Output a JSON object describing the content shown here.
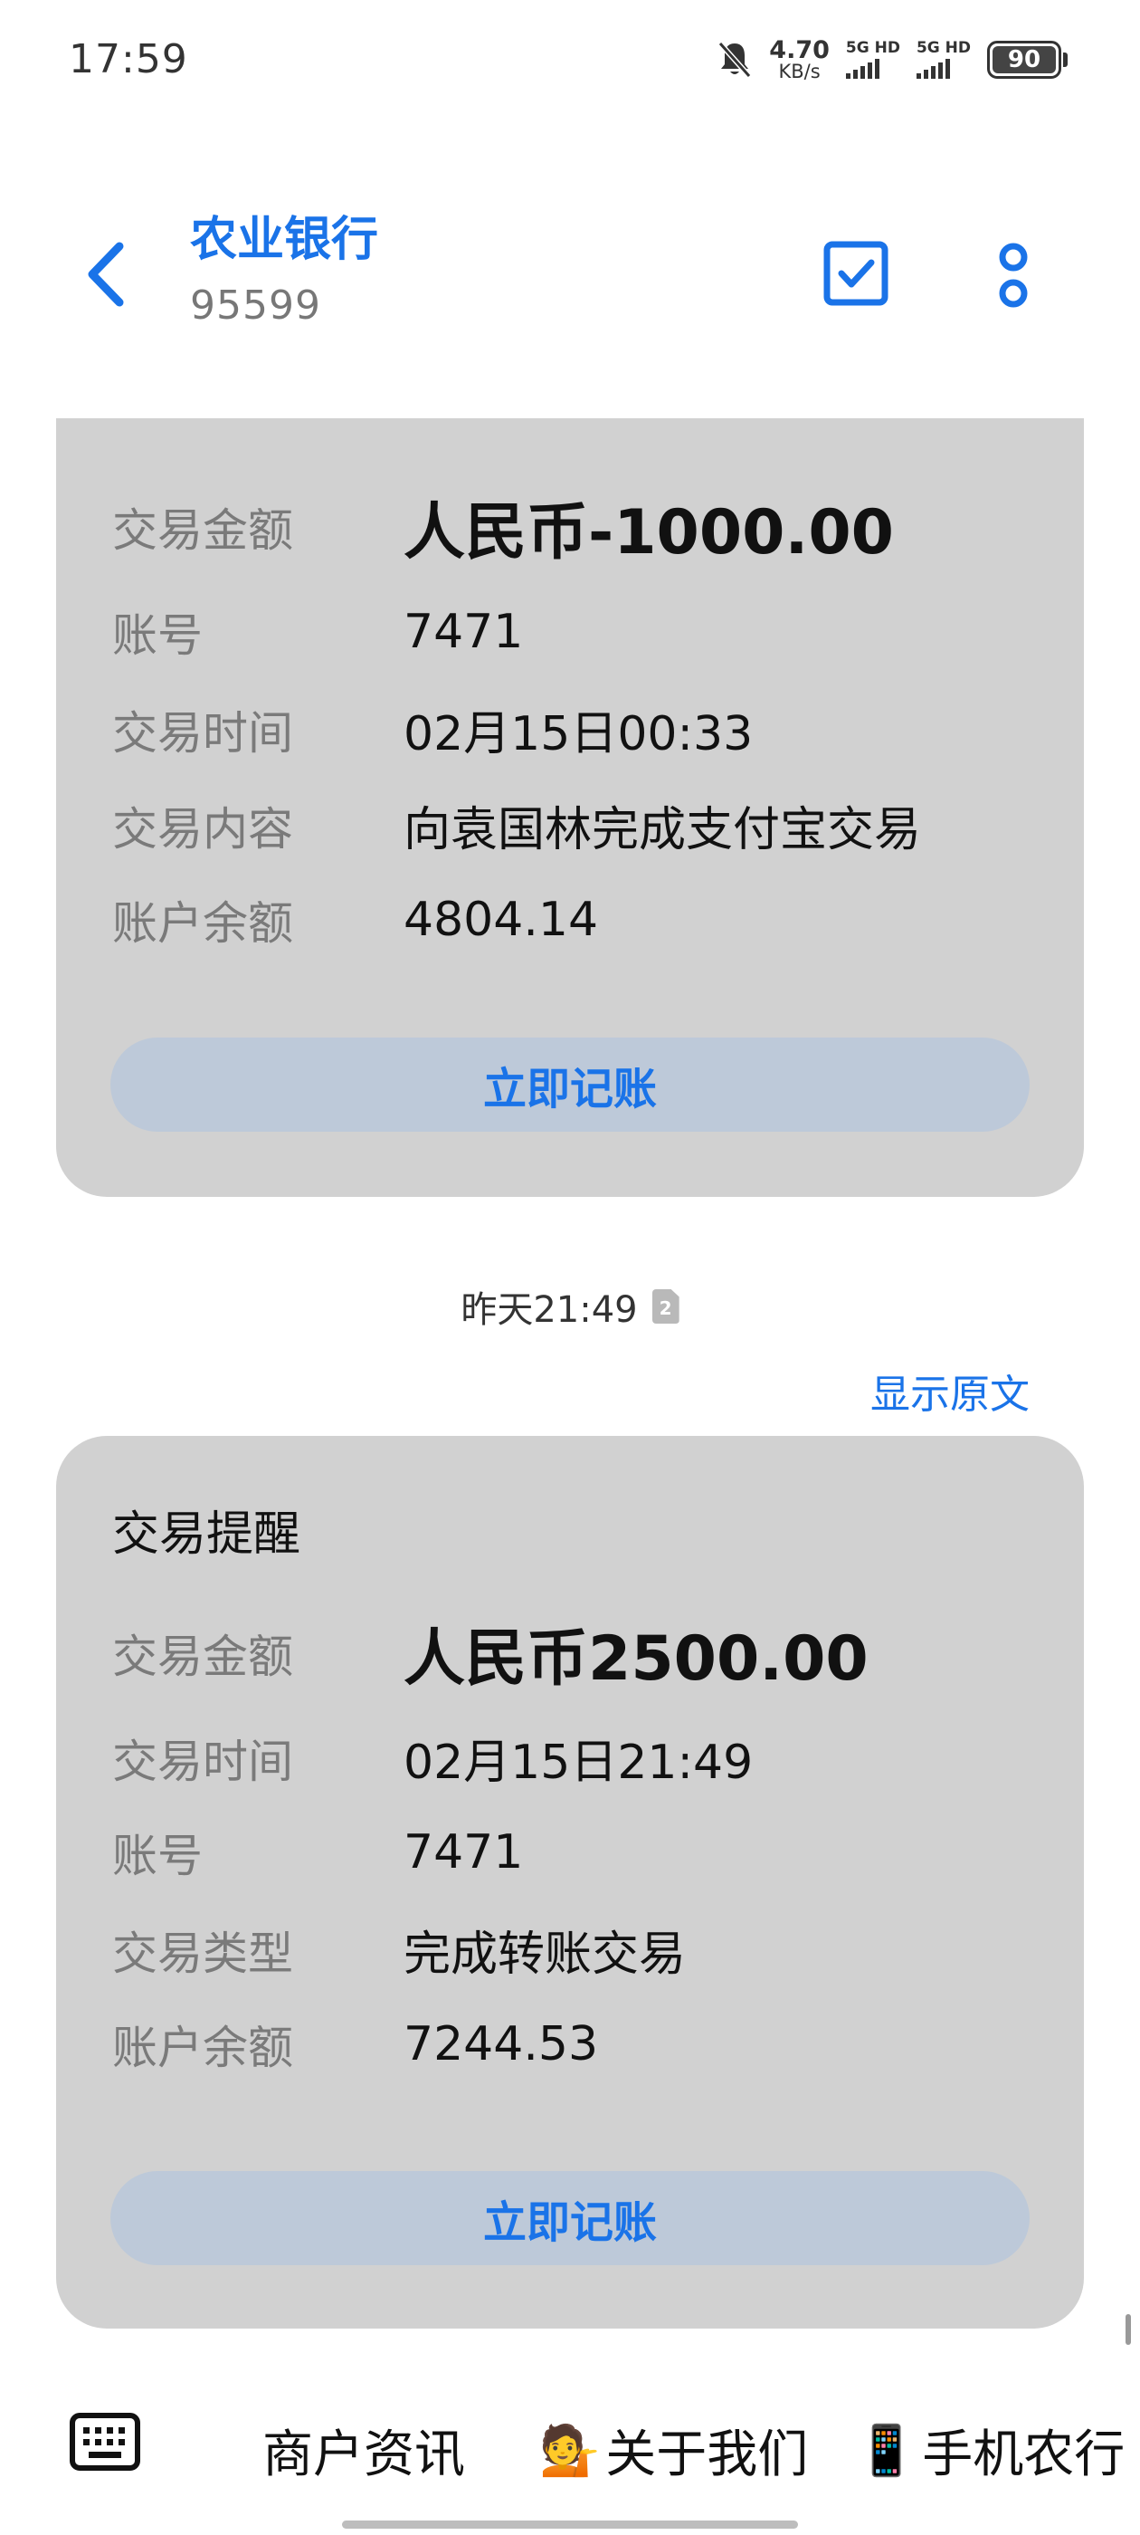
{
  "status_bar": {
    "time": "17:59",
    "net_speed_value": "4.70",
    "net_speed_unit": "KB/s",
    "sim1_label": "5G HD",
    "sim2_label": "5G HD",
    "battery": "90"
  },
  "header": {
    "title": "农业银行",
    "number": "95599"
  },
  "card1": {
    "rows": [
      {
        "key": "交易金额",
        "value": "人民币-1000.00"
      },
      {
        "key": "账号",
        "value": "7471"
      },
      {
        "key": "交易时间",
        "value": "02月15日00:33"
      },
      {
        "key": "交易内容",
        "value": "向袁国林完成支付宝交易"
      },
      {
        "key": "账户余额",
        "value": "4804.14"
      }
    ],
    "button": "立即记账"
  },
  "message_meta": {
    "timestamp": "昨天21:49",
    "sim_slot": "2",
    "show_original": "显示原文"
  },
  "card2": {
    "title": "交易提醒",
    "rows": [
      {
        "key": "交易金额",
        "value": "人民币2500.00"
      },
      {
        "key": "交易时间",
        "value": "02月15日21:49"
      },
      {
        "key": "账号",
        "value": "7471"
      },
      {
        "key": "交易类型",
        "value": "完成转账交易"
      },
      {
        "key": "账户余额",
        "value": "7244.53"
      }
    ],
    "button": "立即记账"
  },
  "bottom_menu": {
    "items": [
      {
        "emoji": "",
        "label": "商户资讯"
      },
      {
        "emoji": "💁",
        "label": "关于我们"
      },
      {
        "emoji": "📱",
        "label": "手机农行"
      }
    ]
  },
  "colors": {
    "accent": "#1a73e8",
    "card_bg": "#d1d1d1",
    "button_bg": "#bdc9d9"
  }
}
